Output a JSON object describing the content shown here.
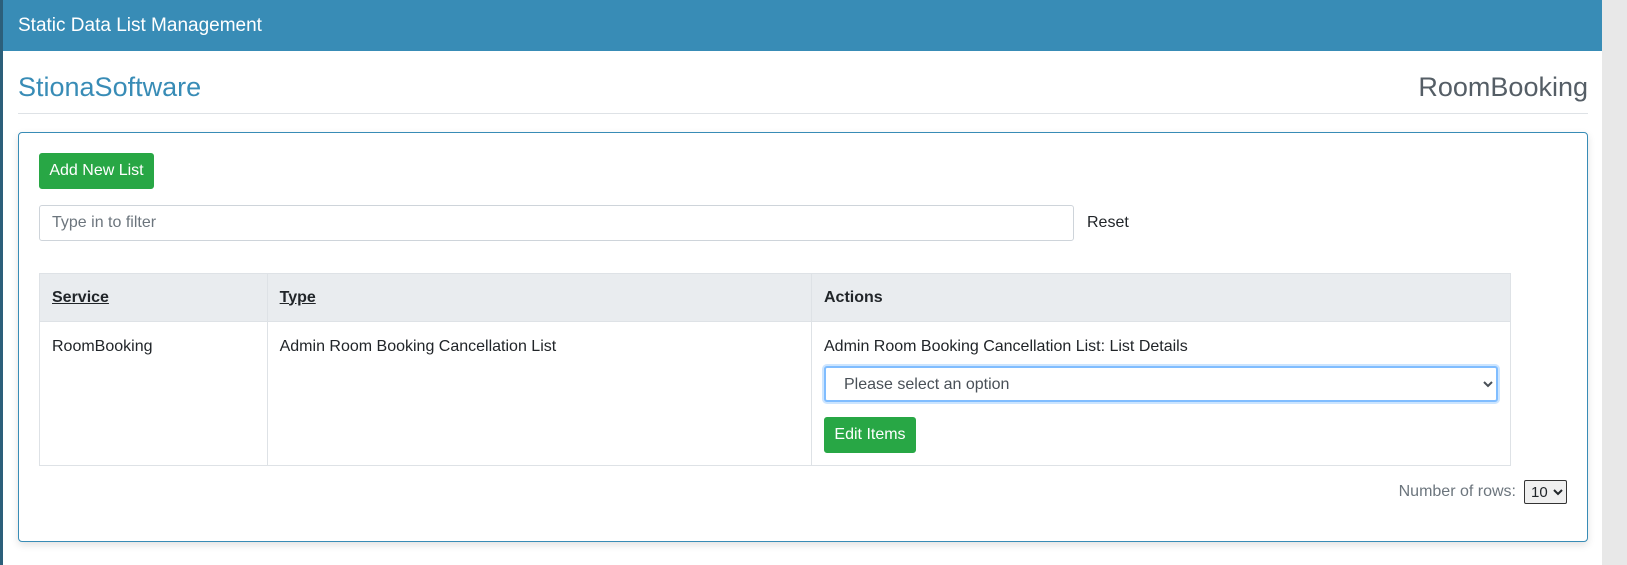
{
  "header": {
    "title": "Static Data List Management"
  },
  "brand": {
    "company": "StionaSoftware",
    "service": "RoomBooking"
  },
  "toolbar": {
    "add_label": "Add New List"
  },
  "filter": {
    "placeholder": "Type in to filter",
    "value": "",
    "reset_label": "Reset"
  },
  "table": {
    "columns": [
      "Service",
      "Type",
      "Actions"
    ],
    "rows": [
      {
        "service": "RoomBooking",
        "type": "Admin Room Booking Cancellation List",
        "action_title": "Admin Room Booking Cancellation List: List Details",
        "select_value": "Please select an option",
        "edit_label": "Edit Items"
      }
    ]
  },
  "pagination": {
    "rows_label": "Number of rows:",
    "rows_value": "10"
  },
  "colors": {
    "header_bg": "#388cb6",
    "brand": "#388cb6",
    "button": "#28a745"
  }
}
